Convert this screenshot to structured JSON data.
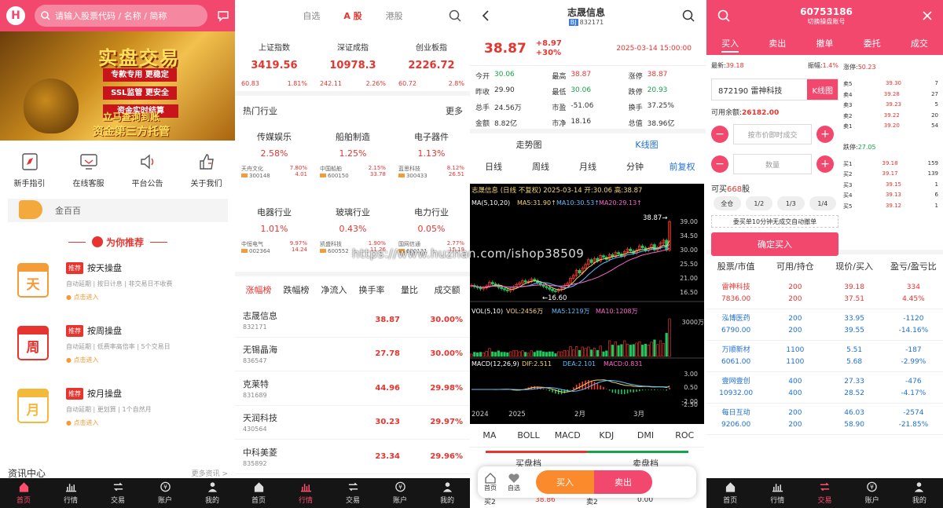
{
  "watermark": "https://www.huzhan.com/ishop38509",
  "tabbar": {
    "home": "首页",
    "market": "行情",
    "trade": "交易",
    "account": "账户",
    "mine": "我的"
  },
  "p1": {
    "logo": "H",
    "search_placeholder": "请输入股票代码 / 名称 / 简称",
    "banner": {
      "title": "实盘交易",
      "lines": [
        "专款专用 更稳定",
        "SSL监管 更安全",
        "资金实时结算",
        "立马查询到账"
      ],
      "bottom": "资金第三方托管"
    },
    "icons": [
      {
        "name": "guide",
        "label": "新手指引"
      },
      {
        "name": "service",
        "label": "在线客服"
      },
      {
        "name": "notice",
        "label": "平台公告"
      },
      {
        "name": "about",
        "label": "关于我们"
      }
    ],
    "notice_text": "金百百",
    "rec_title": "为你推荐",
    "packages": [
      {
        "cal": "天",
        "tag": "推荐",
        "title": "按天操盘",
        "desc": "自动延期 | 按日计息 | 非交易日不收费",
        "link": "点击进入",
        "color": "#f39c38"
      },
      {
        "cal": "周",
        "tag": "推荐",
        "title": "按周操盘",
        "desc": "自动延期 | 低费率高倍率 | 5个交易日",
        "link": "点击进入",
        "color": "#e8342f"
      },
      {
        "cal": "月",
        "tag": "推荐",
        "title": "按月操盘",
        "desc": "自动延期 | 更划算 | 1个自然月",
        "link": "点击进入",
        "color": "#f3b93b"
      }
    ],
    "news_title": "资讯中心",
    "news_more": "更多资讯 >"
  },
  "p2": {
    "tabs": [
      "自选",
      "A 股",
      "港股"
    ],
    "indices": [
      {
        "name": "上证指数",
        "value": "3419.56",
        "chg": "60.83",
        "pct": "1.81%"
      },
      {
        "name": "深证成指",
        "value": "10978.3",
        "chg": "242.11",
        "pct": "2.26%"
      },
      {
        "name": "创业板指",
        "value": "2226.72",
        "chg": "60.72",
        "pct": "2.8%"
      }
    ],
    "hot_title": "热门行业",
    "hot_more": "更多",
    "industries": [
      {
        "name": "传媒娱乐",
        "pct": "2.58%",
        "stock": "天舟文化",
        "code": "300148",
        "p": "7.80%",
        "v": "4.01"
      },
      {
        "name": "船舶制造",
        "pct": "1.25%",
        "stock": "中国船舶",
        "code": "600150",
        "p": "2.15%",
        "v": "33.78"
      },
      {
        "name": "电子器件",
        "pct": "1.13%",
        "stock": "蓝思科技",
        "code": "300433",
        "p": "8.12%",
        "v": "26.51"
      },
      {
        "name": "电器行业",
        "pct": "1.01%",
        "stock": "中恒电气",
        "code": "002364",
        "p": "9.97%",
        "v": "14.24"
      },
      {
        "name": "玻璃行业",
        "pct": "0.43%",
        "stock": "凯盛科技",
        "code": "600552",
        "p": "1.90%",
        "v": "11.26"
      },
      {
        "name": "电力行业",
        "pct": "0.05%",
        "stock": "国网信通",
        "code": "600131",
        "p": "2.77%",
        "v": "15.19"
      }
    ],
    "list_tabs": [
      "涨幅榜",
      "跌幅榜",
      "净流入",
      "换手率",
      "量比",
      "成交额"
    ],
    "rows": [
      {
        "name": "志晟信息",
        "code": "832171",
        "price": "38.87",
        "pct": "30.00%"
      },
      {
        "name": "无锡晶海",
        "code": "836547",
        "price": "27.78",
        "pct": "30.00%"
      },
      {
        "name": "克莱特",
        "code": "831689",
        "price": "44.96",
        "pct": "29.98%"
      },
      {
        "name": "天润科技",
        "code": "430564",
        "price": "30.23",
        "pct": "29.97%"
      },
      {
        "name": "中科美菱",
        "code": "835892",
        "price": "23.34",
        "pct": "29.96%"
      }
    ]
  },
  "p3": {
    "title": "志晟信息",
    "exchange": "BJ",
    "code": "832171",
    "price": "38.87",
    "chg": "+8.97",
    "pct": "+30%",
    "time": "2025-03-14 15:00:00",
    "quotes": [
      {
        "k": "今开",
        "v": "30.06",
        "c": "grn"
      },
      {
        "k": "最高",
        "v": "38.87",
        "c": "red"
      },
      {
        "k": "涨停",
        "v": "38.87",
        "c": "red"
      },
      {
        "k": "昨收",
        "v": "29.90",
        "c": ""
      },
      {
        "k": "最低",
        "v": "30.06",
        "c": "grn"
      },
      {
        "k": "跌停",
        "v": "20.93",
        "c": "grn"
      },
      {
        "k": "总手",
        "v": "24.56万",
        "c": ""
      },
      {
        "k": "市盈",
        "v": "-51.06",
        "c": ""
      },
      {
        "k": "换手",
        "v": "37.25%",
        "c": ""
      },
      {
        "k": "金额",
        "v": "8.82亿",
        "c": ""
      },
      {
        "k": "市净",
        "v": "18.16",
        "c": ""
      },
      {
        "k": "总值",
        "v": "38.96亿",
        "c": ""
      }
    ],
    "chart_tabs": [
      "走势图",
      "K线图"
    ],
    "periods": [
      "日线",
      "周线",
      "月线",
      "分钟",
      "前复权"
    ],
    "chart_head": "志晟信息 (日线 不复权) 2025-03-14 开:30.06 高:38.87",
    "ma_line": [
      "MA(5,10,20)",
      "MA5:31.90↑",
      "MA10:30.53↑",
      "MA20:29.13↑"
    ],
    "vol_line": [
      "VOL(5,10)",
      "VOL:2456万",
      "MA5:1219万",
      "MA10:1208万"
    ],
    "macd_line": [
      "MACD(12,26,9)",
      "DIF:2.511",
      "DEA:2.101",
      "MACD:0.831"
    ],
    "y_price": [
      "39.00",
      "34.50",
      "30.00",
      "25.50",
      "21.00",
      "16.50"
    ],
    "y_vol": "3000万",
    "y_macd": [
      "3.00",
      "0.50",
      "-2.00",
      "-2.50"
    ],
    "x_labels": [
      "2024",
      "2025",
      "2月",
      "3月"
    ],
    "hi_label": "38.87→",
    "lo_label": "←16.60",
    "chart_data": {
      "type": "candlestick",
      "close": [
        18.6,
        18.2,
        17.9,
        17.5,
        17.8,
        18.4,
        19.6,
        19.1,
        18.7,
        18.0,
        17.6,
        17.2,
        16.9,
        17.4,
        18.1,
        18.9,
        19.4,
        20.1,
        19.7,
        19.9,
        20.6,
        20.2,
        19.5,
        18.8,
        18.3,
        17.9,
        17.4,
        16.9,
        16.8,
        17.3,
        17.8,
        18.6,
        19.3,
        20.9,
        21.8,
        23.4,
        22.6,
        24.1,
        25.3,
        26.8,
        25.9,
        27.2,
        26.4,
        28.1,
        27.6,
        26.9,
        28.4,
        27.8,
        29.1,
        28.6,
        27.9,
        29.4,
        30.2,
        29.6,
        28.9,
        29.9,
        31.2,
        30.6,
        29.8,
        30.4,
        31.6,
        29.9,
        30.6,
        32.1,
        33.0,
        29.9,
        38.87
      ],
      "volume_max_label": "3000万"
    },
    "indicators": [
      "MA",
      "BOLL",
      "MACD",
      "KDJ",
      "DMI",
      "ROC"
    ],
    "book": [
      "买盘档",
      "卖盘档"
    ],
    "book_peek": [
      "买2",
      "38.86",
      "卖2",
      "0.00"
    ],
    "bar": {
      "home": "首页",
      "fav": "自选",
      "buy": "买入",
      "sell": "卖出"
    }
  },
  "p4": {
    "account": "60753186",
    "switch": "切换操盘账号",
    "tabs": [
      "买入",
      "卖出",
      "撤单",
      "委托",
      "成交"
    ],
    "latest_k": "最新:",
    "latest_v": "39.18",
    "amp_k": "振幅:",
    "amp_v": "1.4%",
    "stock": "872190 雷神科技",
    "kbtn": "K线图",
    "avail_k": "可用余额:",
    "avail_v": "26182.00",
    "price_ph": "按市价即时成交",
    "qty_ph": "数量",
    "canbuy_k": "可买",
    "canbuy_v": "668",
    "canbuy_u": "股",
    "ratios": [
      "全仓",
      "1/2",
      "1/3",
      "1/4"
    ],
    "tip": "委买单10分钟无成交自动撤单",
    "confirm": "确定买入",
    "limit_up_k": "涨停:",
    "limit_up_v": "50.23",
    "limit_dn_k": "跌停:",
    "limit_dn_v": "27.05",
    "asks": [
      {
        "k": "卖5",
        "p": "39.30",
        "q": "7"
      },
      {
        "k": "卖4",
        "p": "39.28",
        "q": "27"
      },
      {
        "k": "卖3",
        "p": "39.23",
        "q": "5"
      },
      {
        "k": "卖2",
        "p": "39.22",
        "q": "20"
      },
      {
        "k": "卖1",
        "p": "39.20",
        "q": "54"
      }
    ],
    "bids": [
      {
        "k": "买1",
        "p": "39.18",
        "q": "159"
      },
      {
        "k": "买2",
        "p": "39.17",
        "q": "139"
      },
      {
        "k": "买3",
        "p": "39.15",
        "q": "1"
      },
      {
        "k": "买4",
        "p": "39.13",
        "q": "6"
      },
      {
        "k": "买5",
        "p": "39.12",
        "q": "1"
      }
    ],
    "pos_head": [
      "股票/市值",
      "可用/持仓",
      "现价/买入",
      "盈亏/盈亏比"
    ],
    "positions": [
      {
        "n": "雷神科技",
        "m": "7836.00",
        "a": "200",
        "h": "200",
        "cur": "39.18",
        "buy": "37.51",
        "pl": "334",
        "pr": "4.45%"
      },
      {
        "n": "泓博医药",
        "m": "6790.00",
        "a": "200",
        "h": "200",
        "cur": "33.95",
        "buy": "39.55",
        "pl": "-1120",
        "pr": "-14.16%"
      },
      {
        "n": "万顺新材",
        "m": "6061.00",
        "a": "1100",
        "h": "1100",
        "cur": "5.51",
        "buy": "5.68",
        "pl": "-187",
        "pr": "-2.99%"
      },
      {
        "n": "壹网壹创",
        "m": "10932.00",
        "a": "400",
        "h": "400",
        "cur": "27.33",
        "buy": "28.52",
        "pl": "-476",
        "pr": "-4.17%"
      },
      {
        "n": "每日互动",
        "m": "9206.00",
        "a": "200",
        "h": "200",
        "cur": "46.03",
        "buy": "58.90",
        "pl": "-2574",
        "pr": "-21.85%"
      }
    ]
  }
}
